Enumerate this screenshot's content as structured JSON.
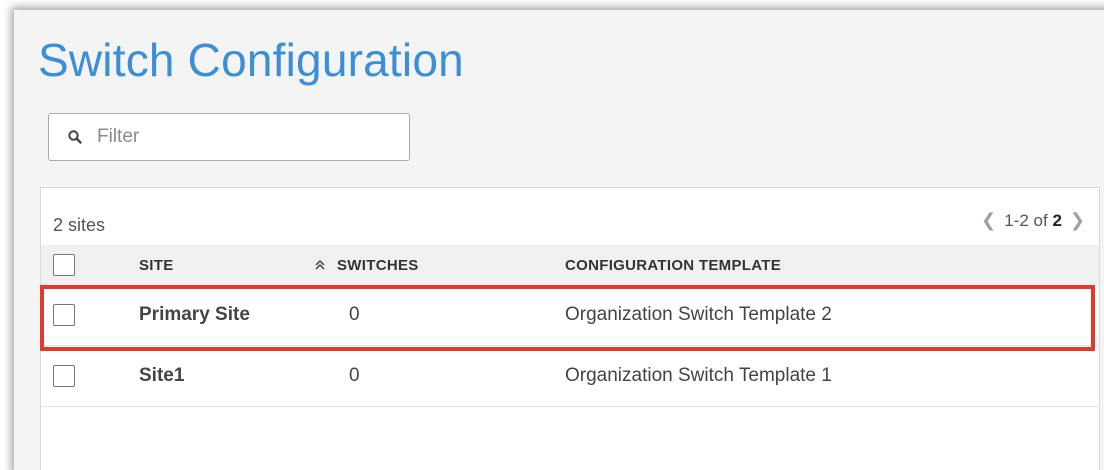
{
  "page": {
    "title": "Switch Configuration"
  },
  "filter": {
    "placeholder": "Filter",
    "icon": "search-icon"
  },
  "table": {
    "count_label": "2 sites",
    "pager": {
      "range": "1-2 of",
      "total": "2"
    },
    "columns": {
      "site": "SITE",
      "switches": "SWITCHES",
      "template": "CONFIGURATION TEMPLATE"
    },
    "rows": [
      {
        "site": "Primary Site",
        "switches": "0",
        "template": "Organization Switch Template 2"
      },
      {
        "site": "Site1",
        "switches": "0",
        "template": "Organization Switch Template 1"
      }
    ]
  },
  "colors": {
    "title": "#3a8fd8",
    "highlight": "#e03a2a"
  }
}
